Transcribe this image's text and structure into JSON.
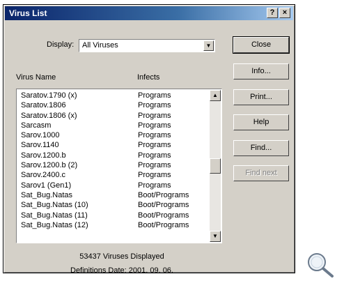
{
  "window": {
    "title": "Virus List",
    "help_label": "?",
    "close_label": "×"
  },
  "display": {
    "label": "Display:",
    "value": "All Viruses"
  },
  "columns": {
    "name": "Virus Name",
    "infects": "Infects"
  },
  "viruses": [
    {
      "name": "Saratov.1790 (x)",
      "infects": "Programs"
    },
    {
      "name": "Saratov.1806",
      "infects": "Programs"
    },
    {
      "name": "Saratov.1806 (x)",
      "infects": "Programs"
    },
    {
      "name": "Sarcasm",
      "infects": "Programs"
    },
    {
      "name": "Sarov.1000",
      "infects": "Programs"
    },
    {
      "name": "Sarov.1140",
      "infects": "Programs"
    },
    {
      "name": "Sarov.1200.b",
      "infects": "Programs"
    },
    {
      "name": "Sarov.1200.b (2)",
      "infects": "Programs"
    },
    {
      "name": "Sarov.2400.c",
      "infects": "Programs"
    },
    {
      "name": "Sarov1 (Gen1)",
      "infects": "Programs"
    },
    {
      "name": "Sat_Bug.Natas",
      "infects": "Boot/Programs"
    },
    {
      "name": "Sat_Bug.Natas (10)",
      "infects": "Boot/Programs"
    },
    {
      "name": "Sat_Bug.Natas (11)",
      "infects": "Boot/Programs"
    },
    {
      "name": "Sat_Bug.Natas (12)",
      "infects": "Boot/Programs"
    }
  ],
  "buttons": {
    "close": "Close",
    "info": "Info...",
    "print": "Print...",
    "help": "Help",
    "find": "Find...",
    "find_next": "Find next"
  },
  "status": {
    "count": "53437 Viruses Displayed",
    "definitions": "Definitions Date: 2001. 09. 06."
  }
}
